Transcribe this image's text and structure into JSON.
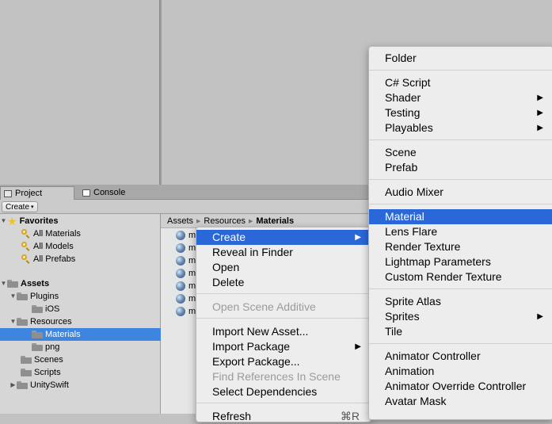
{
  "tabs": {
    "project": "Project",
    "console": "Console"
  },
  "toolbar": {
    "create_label": "Create",
    "create_caret": "▾"
  },
  "sidebar": {
    "favorites": {
      "label": "Favorites",
      "items": [
        "All Materials",
        "All Models",
        "All Prefabs"
      ]
    },
    "assets": {
      "label": "Assets",
      "tree": [
        {
          "label": "Plugins",
          "expanded": true
        },
        {
          "label": "iOS"
        },
        {
          "label": "Resources",
          "expanded": true
        },
        {
          "label": "Materials",
          "selected": true
        },
        {
          "label": "png"
        },
        {
          "label": "Scenes"
        },
        {
          "label": "Scripts"
        },
        {
          "label": "UnitySwift",
          "expanded": false
        }
      ]
    }
  },
  "breadcrumb": [
    "Assets",
    "Resources",
    "Materials"
  ],
  "assets_list": {
    "items": [
      "m",
      "m",
      "m",
      "m",
      "m",
      "m",
      "m"
    ]
  },
  "context_menu": {
    "items": [
      {
        "label": "Create",
        "highlighted": true,
        "submenu": true
      },
      {
        "label": "Reveal in Finder"
      },
      {
        "label": "Open"
      },
      {
        "label": "Delete"
      },
      {
        "label": "Open Scene Additive",
        "disabled": true
      },
      {
        "label": "Import New Asset..."
      },
      {
        "label": "Import Package",
        "submenu": true
      },
      {
        "label": "Export Package..."
      },
      {
        "label": "Find References In Scene",
        "disabled": true
      },
      {
        "label": "Select Dependencies"
      },
      {
        "label": "Refresh",
        "shortcut": "⌘R"
      }
    ]
  },
  "create_submenu": {
    "items": [
      {
        "label": "Folder"
      },
      {
        "label": "C# Script"
      },
      {
        "label": "Shader",
        "submenu": true
      },
      {
        "label": "Testing",
        "submenu": true
      },
      {
        "label": "Playables",
        "submenu": true
      },
      {
        "label": "Scene"
      },
      {
        "label": "Prefab"
      },
      {
        "label": "Audio Mixer"
      },
      {
        "label": "Material",
        "highlighted": true
      },
      {
        "label": "Lens Flare"
      },
      {
        "label": "Render Texture"
      },
      {
        "label": "Lightmap Parameters"
      },
      {
        "label": "Custom Render Texture"
      },
      {
        "label": "Sprite Atlas"
      },
      {
        "label": "Sprites",
        "submenu": true
      },
      {
        "label": "Tile"
      },
      {
        "label": "Animator Controller"
      },
      {
        "label": "Animation"
      },
      {
        "label": "Animator Override Controller"
      },
      {
        "label": "Avatar Mask"
      }
    ]
  },
  "icons": {
    "submenu_arrow": "▶",
    "expanded_arrow": "▼",
    "collapsed_arrow": "▶",
    "breadcrumb_sep": "▶"
  },
  "colors": {
    "selection": "#3d85de",
    "menu_highlight": "#2a67d8"
  }
}
